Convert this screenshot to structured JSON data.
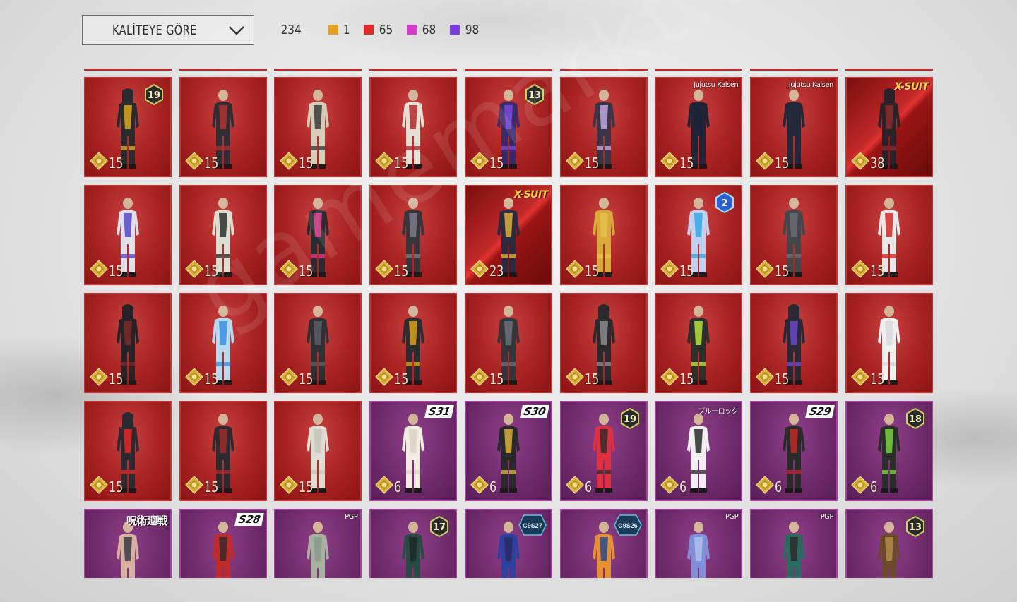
{
  "sort": {
    "label": "KALİTEYE GÖRE"
  },
  "counts": {
    "total": "234",
    "tiers": [
      {
        "value": "1",
        "color": "#e8a020"
      },
      {
        "value": "65",
        "color": "#e02a2a"
      },
      {
        "value": "68",
        "color": "#d43cc8"
      },
      {
        "value": "98",
        "color": "#7a3ae0"
      }
    ]
  },
  "watermark": "gamemarkt.com",
  "colors": {
    "legendary_bg": "#a82222",
    "epic_bg": "#6e2a6a",
    "price_text": "#f1e7d0",
    "coin_gold": "#d8b23a"
  },
  "items": [
    {
      "tier": "red",
      "price": "15",
      "badge": {
        "type": "level",
        "text": "19"
      },
      "outfit": {
        "c1": "#2a2a2e",
        "c2": "#d8a820",
        "hood": true
      }
    },
    {
      "tier": "red",
      "price": "15",
      "badge": null,
      "outfit": {
        "c1": "#2e2e34",
        "c2": "#b03030"
      }
    },
    {
      "tier": "red",
      "price": "15",
      "badge": null,
      "outfit": {
        "c1": "#d6cdb8",
        "c2": "#3a3a3a"
      }
    },
    {
      "tier": "red",
      "price": "15",
      "badge": null,
      "outfit": {
        "c1": "#e6e0d4",
        "c2": "#b02a2a"
      }
    },
    {
      "tier": "red",
      "price": "15",
      "badge": {
        "type": "level",
        "text": "13"
      },
      "outfit": {
        "c1": "#3a2a6a",
        "c2": "#7a48d8"
      }
    },
    {
      "tier": "red",
      "price": "15",
      "badge": null,
      "outfit": {
        "c1": "#3a3448",
        "c2": "#c0a8e0"
      }
    },
    {
      "tier": "red",
      "price": "15",
      "badge": {
        "type": "small",
        "text": "Jujutsu Kaisen"
      },
      "outfit": {
        "c1": "#1e2538",
        "c2": "#1e2538"
      }
    },
    {
      "tier": "red",
      "price": "15",
      "badge": {
        "type": "small",
        "text": "Jujutsu Kaisen"
      },
      "outfit": {
        "c1": "#22283a",
        "c2": "#22283a"
      }
    },
    {
      "tier": "xs",
      "price": "38",
      "badge": {
        "type": "xsuit",
        "text": "X-SUIT"
      },
      "outfit": {
        "c1": "#2a2228",
        "c2": "#8a2a2a",
        "hood": true
      }
    },
    {
      "tier": "red",
      "price": "15",
      "badge": null,
      "outfit": {
        "c1": "#e0e0ea",
        "c2": "#5a48c8"
      }
    },
    {
      "tier": "red",
      "price": "15",
      "badge": null,
      "outfit": {
        "c1": "#dcdcd0",
        "c2": "#2e2e2e"
      }
    },
    {
      "tier": "red",
      "price": "15",
      "badge": null,
      "outfit": {
        "c1": "#2a2a30",
        "c2": "#e03a8a"
      }
    },
    {
      "tier": "red",
      "price": "15",
      "badge": null,
      "outfit": {
        "c1": "#38343c",
        "c2": "#7a7a86"
      }
    },
    {
      "tier": "xs",
      "price": "23",
      "badge": {
        "type": "xsuit",
        "text": "X-SUIT"
      },
      "outfit": {
        "c1": "#2a2a40",
        "c2": "#d8b040"
      }
    },
    {
      "tier": "red",
      "price": "15",
      "badge": null,
      "outfit": {
        "c1": "#d8a838",
        "c2": "#e8c050"
      }
    },
    {
      "tier": "red",
      "price": "15",
      "badge": {
        "type": "level-blue",
        "text": "2"
      },
      "outfit": {
        "c1": "#c0d0f0",
        "c2": "#38a8e0"
      }
    },
    {
      "tier": "red",
      "price": "15",
      "badge": null,
      "outfit": {
        "c1": "#44464c",
        "c2": "#6a6c72"
      }
    },
    {
      "tier": "red",
      "price": "15",
      "badge": null,
      "outfit": {
        "c1": "#e8e8e8",
        "c2": "#d02828"
      }
    },
    {
      "tier": "red",
      "price": "15",
      "badge": null,
      "outfit": {
        "c1": "#262228",
        "c2": "#7a2a2a",
        "hood": true
      }
    },
    {
      "tier": "red",
      "price": "15",
      "badge": null,
      "outfit": {
        "c1": "#b8d8f0",
        "c2": "#3a90e0"
      }
    },
    {
      "tier": "red",
      "price": "15",
      "badge": null,
      "outfit": {
        "c1": "#2e3034",
        "c2": "#5a5e66"
      }
    },
    {
      "tier": "red",
      "price": "15",
      "badge": null,
      "outfit": {
        "c1": "#2a2c30",
        "c2": "#d8a020"
      }
    },
    {
      "tier": "red",
      "price": "15",
      "badge": null,
      "outfit": {
        "c1": "#34363c",
        "c2": "#6a6e78"
      }
    },
    {
      "tier": "red",
      "price": "15",
      "badge": null,
      "outfit": {
        "c1": "#2a2a2e",
        "c2": "#8a8a8e",
        "hood": true
      }
    },
    {
      "tier": "red",
      "price": "15",
      "badge": null,
      "outfit": {
        "c1": "#2c302c",
        "c2": "#b8e040"
      }
    },
    {
      "tier": "red",
      "price": "15",
      "badge": null,
      "outfit": {
        "c1": "#2a2834",
        "c2": "#6a48c8",
        "hood": true
      }
    },
    {
      "tier": "red",
      "price": "15",
      "badge": null,
      "outfit": {
        "c1": "#f0f0f0",
        "c2": "#d8d8d8"
      }
    },
    {
      "tier": "red",
      "price": "15",
      "badge": null,
      "outfit": {
        "c1": "#2a2a30",
        "c2": "#e02a2a",
        "hood": true
      }
    },
    {
      "tier": "red",
      "price": "15",
      "badge": null,
      "outfit": {
        "c1": "#2c2a2e",
        "c2": "#a02a2a"
      }
    },
    {
      "tier": "red",
      "price": "15",
      "badge": null,
      "outfit": {
        "c1": "#e0dcd4",
        "c2": "#c8c4bc"
      }
    },
    {
      "tier": "purple",
      "price": "6",
      "badge": {
        "type": "season",
        "text": "S31"
      },
      "outfit": {
        "c1": "#f0ece0",
        "c2": "#d8d4c8"
      }
    },
    {
      "tier": "purple",
      "price": "6",
      "badge": {
        "type": "season",
        "text": "S30"
      },
      "outfit": {
        "c1": "#2a2a2a",
        "c2": "#d8b040"
      }
    },
    {
      "tier": "purple",
      "price": "6",
      "badge": {
        "type": "level",
        "text": "19"
      },
      "outfit": {
        "c1": "#e03040",
        "c2": "#3a2a2a"
      }
    },
    {
      "tier": "purple",
      "price": "6",
      "badge": {
        "type": "small",
        "text": "ブルーロック"
      },
      "outfit": {
        "c1": "#f0f0f0",
        "c2": "#2a2a2a"
      }
    },
    {
      "tier": "purple",
      "price": "6",
      "badge": {
        "type": "season",
        "text": "S29"
      },
      "outfit": {
        "c1": "#2a2a2a",
        "c2": "#c02828"
      }
    },
    {
      "tier": "purple",
      "price": "6",
      "badge": {
        "type": "level",
        "text": "18"
      },
      "outfit": {
        "c1": "#2a2e28",
        "c2": "#7ad040"
      }
    },
    {
      "tier": "purple",
      "price": "",
      "badge": {
        "type": "cjk",
        "text": "呪術廻戦"
      },
      "outfit": {
        "c1": "#d8b0a0",
        "c2": "#3a3a44"
      }
    },
    {
      "tier": "purple",
      "price": "",
      "badge": {
        "type": "season",
        "text": "S28"
      },
      "outfit": {
        "c1": "#c02a2a",
        "c2": "#3a2a2a"
      }
    },
    {
      "tier": "purple",
      "price": "",
      "badge": {
        "type": "small",
        "text": "PGP"
      },
      "outfit": {
        "c1": "#a8b0a0",
        "c2": "#8a9a8a"
      }
    },
    {
      "tier": "purple",
      "price": "",
      "badge": {
        "type": "level",
        "text": "17"
      },
      "outfit": {
        "c1": "#2a4a44",
        "c2": "#1a2a28"
      }
    },
    {
      "tier": "purple",
      "price": "",
      "badge": {
        "type": "hex",
        "text": "C9S27"
      },
      "outfit": {
        "c1": "#3040a0",
        "c2": "#2a2a60"
      }
    },
    {
      "tier": "purple",
      "price": "",
      "badge": {
        "type": "hex",
        "text": "C9S26"
      },
      "outfit": {
        "c1": "#e89030",
        "c2": "#2a4a8a"
      }
    },
    {
      "tier": "purple",
      "price": "",
      "badge": {
        "type": "small",
        "text": "PGP"
      },
      "outfit": {
        "c1": "#8090d8",
        "c2": "#b0c0f0"
      }
    },
    {
      "tier": "purple",
      "price": "",
      "badge": {
        "type": "small",
        "text": "PGP"
      },
      "outfit": {
        "c1": "#2a6a60",
        "c2": "#2a2a2a"
      }
    },
    {
      "tier": "purple",
      "price": "",
      "badge": {
        "type": "level",
        "text": "13"
      },
      "outfit": {
        "c1": "#6a4a2a",
        "c2": "#b08a4a"
      }
    }
  ]
}
